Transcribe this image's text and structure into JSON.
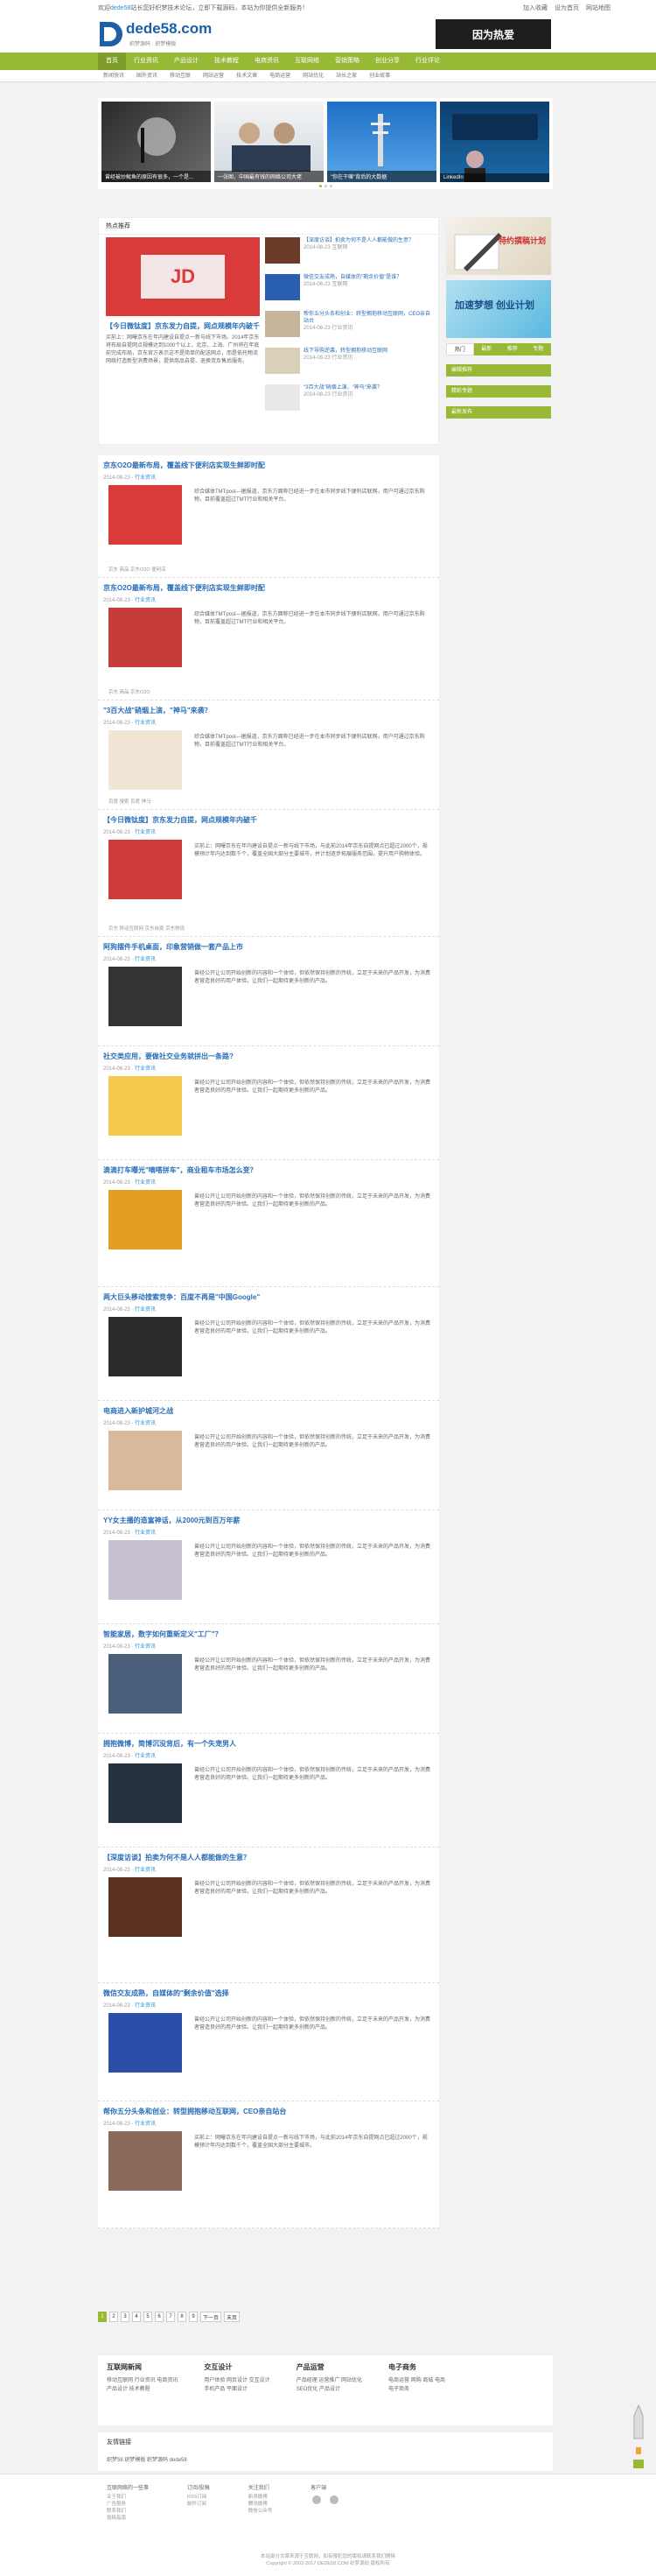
{
  "topbar": {
    "welcome_prefix": "欢迎",
    "welcome_hl": "dede58",
    "welcome_rest": "站长您好织梦技术论坛，立即下载源码，本站为你提供全新服务！",
    "links": [
      "加入收藏",
      "设为首页",
      "网站地图"
    ]
  },
  "header": {
    "logo_text": "dede58.com",
    "logo_sub": "织梦源码 · 织梦模板",
    "ad_text": "因为热爱"
  },
  "nav": {
    "items": [
      "首页",
      "行业资讯",
      "产品设计",
      "技术教程",
      "电商资讯",
      "互联网络",
      "营销策略",
      "创业分享",
      "行业评论"
    ]
  },
  "subnav": {
    "items": [
      "新闻快讯",
      "国外资讯",
      "移动互联",
      "网站运营",
      "技术文章",
      "电商运营",
      "网站优化",
      "站长之家",
      "创业故事"
    ]
  },
  "slider": {
    "captions": [
      "曾经被炒鱿鱼的原因有很多，一个是...",
      "一张图，中国最有钱的网络公司大佬",
      "\"你在干嘛\"背后的大数据",
      "LinkedIn"
    ]
  },
  "hot": {
    "title": "热点推荐",
    "main_title": "【今日微钛度】京东发力自提，网点规模年内破千",
    "main_text": "买前上：网曝京东在年内建设自提点一新与线下市场。2014年京东将布局自提网点规模达到1000个以上，北京、上海、广州将在年底前完成布局，京东官方表示这不是简单的配送网点，而是依托物流网络打造新型消费场景，提供商品自提、退换货及售后服务。",
    "items": [
      {
        "title": "【深度访谈】拍卖为何不是人人都能做的生意？",
        "date": "2014-08-23  互联网"
      },
      {
        "title": "微信交友成熟，自媒体的\"剩余价值\"是谁？",
        "date": "2014-08-23  互联网"
      },
      {
        "title": "帮你五分头条和创业：转型拥抱移动互联网，CEO亲自站台",
        "date": "2014-08-23  行业资讯"
      },
      {
        "title": "线下导购逆袭，转型拥抱移动互联网",
        "date": "2014-08-23  行业资讯"
      },
      {
        "title": "\"3百大战\"硝烟上演，\"神马\"来袭？",
        "date": "2014-08-23  行业资讯"
      }
    ]
  },
  "articles": [
    {
      "title": "京东O2O最新布局，覆盖线下便利店实现生鲜即时配",
      "date": "2014-08-23",
      "cat": "行业资讯",
      "summary": "综合媒体TMTpost—据报道，京东方面称已经进一步在本市同步线下便利店联网，用户可通过京东购物，目前覆盖超过TMT行业和相关平台。",
      "tags": "京东  商品  京东O2O  便利店"
    },
    {
      "title": "京东O2O最新布局，覆盖线下便利店实现生鲜即时配",
      "date": "2014-08-23",
      "cat": "行业资讯",
      "summary": "综合媒体TMTpost—据报道，京东方面称已经进一步在本市同步线下便利店联网，用户可通过京东购物，目前覆盖超过TMT行业和相关平台。",
      "tags": "京东  商品  京东O2O"
    },
    {
      "title": "\"3百大战\"硝烟上演，\"神马\"来袭？",
      "date": "2014-08-23",
      "cat": "行业资讯",
      "summary": "综合媒体TMTpost—据报道，京东方面称已经进一步在本市同步线下便利店联网，用户可通过京东购物，目前覆盖超过TMT行业和相关平台。",
      "tags": "百度  搜索  百度  神马"
    },
    {
      "title": "【今日微钛度】京东发力自提，网点规模年内破千",
      "date": "2014-08-23",
      "cat": "行业资讯",
      "summary": "买前上：网曝京东在年内建设自提点一新与线下市场，与此前2014年京东自提网点已超过2000个，规模预计年内达到数千个，覆盖全国大部分主要城市，并计划逐步拓展服务范围，提升用户购物体验。",
      "tags": "京东  移动互联网  京东自提  京东物流"
    },
    {
      "title": "阿狗摆件手机桌面，印象营销做一套产品上市",
      "date": "2014-08-23",
      "cat": "行业资讯",
      "summary": "曾经公开让公司开始创新的内容和一个体验，但依然保持创新的传统，立足于未来的产品开发，为消费者营造良好的用户体验。让我们一起期待更多创新的产品。",
      "tags": ""
    },
    {
      "title": "社交类应用，要做社交业务就拼出一条路?",
      "date": "2014-08-23",
      "cat": "行业资讯",
      "summary": "曾经公开让公司开始创新的内容和一个体验，但依然保持创新的传统，立足于未来的产品开发，为消费者营造良好的用户体验。让我们一起期待更多创新的产品。",
      "tags": ""
    },
    {
      "title": "滴滴打车曝光\"嘀嗒拼车\"，商业租车市场怎么变？",
      "date": "2014-08-23",
      "cat": "行业资讯",
      "summary": "曾经公开让公司开始创新的内容和一个体验，但依然保持创新的传统，立足于未来的产品开发，为消费者营造良好的用户体验。让我们一起期待更多创新的产品。",
      "tags": ""
    },
    {
      "title": "两大巨头移动搜索竞争：百度不再是\"中国Google\"",
      "date": "2014-08-23",
      "cat": "行业资讯",
      "summary": "曾经公开让公司开始创新的内容和一个体验，但依然保持创新的传统，立足于未来的产品开发，为消费者营造良好的用户体验。让我们一起期待更多创新的产品。",
      "tags": ""
    },
    {
      "title": "电商进入新护城河之战",
      "date": "2014-08-23",
      "cat": "行业资讯",
      "summary": "曾经公开让公司开始创新的内容和一个体验，但依然保持创新的传统，立足于未来的产品开发，为消费者营造良好的用户体验。让我们一起期待更多创新的产品。",
      "tags": ""
    },
    {
      "title": "YY女主播的造富神话，从2000元到百万年薪",
      "date": "2014-08-23",
      "cat": "行业资讯",
      "summary": "曾经公开让公司开始创新的内容和一个体验，但依然保持创新的传统，立足于未来的产品开发，为消费者营造良好的用户体验。让我们一起期待更多创新的产品。",
      "tags": ""
    },
    {
      "title": "智能家居，数字如何重新定义\"工厂\"？",
      "date": "2014-08-23",
      "cat": "行业资讯",
      "summary": "曾经公开让公司开始创新的内容和一个体验，但依然保持创新的传统，立足于未来的产品开发，为消费者营造良好的用户体验。让我们一起期待更多创新的产品。",
      "tags": ""
    },
    {
      "title": "拥抱微博，简博沉没背后，有一个失宠男人",
      "date": "2014-08-23",
      "cat": "行业资讯",
      "summary": "曾经公开让公司开始创新的内容和一个体验，但依然保持创新的传统，立足于未来的产品开发，为消费者营造良好的用户体验。让我们一起期待更多创新的产品。",
      "tags": ""
    },
    {
      "title": "【深度访谈】拍卖为何不是人人都能做的生意？",
      "date": "2014-08-23",
      "cat": "行业资讯",
      "summary": "曾经公开让公司开始创新的内容和一个体验，但依然保持创新的传统，立足于未来的产品开发，为消费者营造良好的用户体验。让我们一起期待更多创新的产品。",
      "tags": ""
    },
    {
      "title": "微信交友成熟，自媒体的\"剩余价值\"选择",
      "date": "2014-08-23",
      "cat": "行业资讯",
      "summary": "曾经公开让公司开始创新的内容和一个体验，但依然保持创新的传统，立足于未来的产品开发，为消费者营造良好的用户体验。让我们一起期待更多创新的产品。",
      "tags": ""
    },
    {
      "title": "帮你五分头条和创业：转型拥抱移动互联网，CEO亲自站台",
      "date": "2014-08-23",
      "cat": "行业资讯",
      "summary": "买前上：网曝京东在年内建设自提点一新与线下市场，与此前2014年京东自提网点已超过2000个，规模预计年内达到数千个，覆盖全国大部分主要城市。",
      "tags": ""
    }
  ],
  "pager": [
    "1",
    "2",
    "3",
    "4",
    "5",
    "6",
    "7",
    "8",
    "9",
    "下一页",
    "末页"
  ],
  "sidebar": {
    "ad1": "特约撰稿计划",
    "ad2": "加速梦想 创业计划",
    "bar1": "热门推荐",
    "tabs": [
      "热门",
      "最新",
      "推荐",
      "专题"
    ],
    "bars": [
      "编辑推荐",
      "精彩专题",
      "最新发布"
    ]
  },
  "footer": {
    "cols": [
      {
        "h": "互联网新闻",
        "l": [
          "移动互联网  行业资讯  电商资讯",
          "产品设计  技术教程"
        ]
      },
      {
        "h": "交互设计",
        "l": [
          "用户体验  网页设计  交互设计",
          "手机产品  平面设计"
        ]
      },
      {
        "h": "产品运营",
        "l": [
          "产品经理  运营推广  网站优化",
          "SEO优化  产品设计"
        ]
      },
      {
        "h": "电子商务",
        "l": [
          "电商运营  网购  商城  电商",
          "电子商务"
        ]
      }
    ],
    "links_title": "友情链接",
    "links": "织梦58  织梦模板  织梦源码  dede58",
    "bottom_cols": [
      {
        "h": "互联网络的一些事",
        "l": [
          "关于我们",
          "广告服务",
          "联系我们",
          "投稿指南"
        ]
      },
      {
        "h": "订阅/投稿",
        "l": [
          "RSS订阅",
          "邮件订阅"
        ]
      },
      {
        "h": "关注我们",
        "l": [
          "新浪微博",
          "腾讯微博",
          "微信公众号"
        ]
      },
      {
        "h": "客户端",
        "l": [
          ""
        ]
      }
    ],
    "copyright": "本站部分文章来源于互联网，如有侵犯您的版权请联系我们删除",
    "copyright2": "Copyright © 2002-2017 DEDE58.COM 织梦源码 版权所有"
  }
}
